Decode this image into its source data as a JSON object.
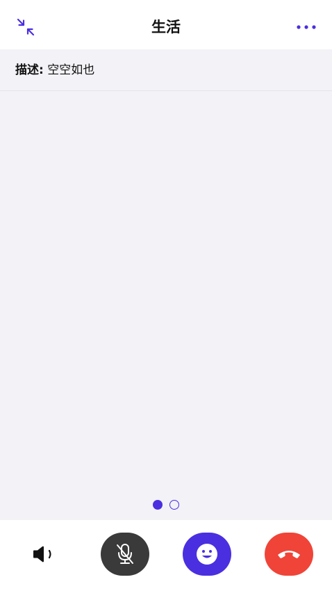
{
  "header": {
    "title": "生活",
    "collapse_icon": "collapse-arrows-icon",
    "more_icon": "more-dots-icon"
  },
  "description": {
    "label": "描述",
    "separator": ":",
    "value": "空空如也"
  },
  "pager": {
    "total": 2,
    "active_index": 0
  },
  "controls": [
    {
      "name": "speaker",
      "icon": "speaker-icon"
    },
    {
      "name": "mute-mic",
      "icon": "mic-off-icon"
    },
    {
      "name": "emoji",
      "icon": "smiley-icon"
    },
    {
      "name": "hang-up",
      "icon": "phone-hangup-icon"
    }
  ],
  "colors": {
    "accent": "#4a2fe0",
    "hangup": "#f04438",
    "mic_button": "#3a3a3a",
    "background": "#f2f2f7"
  }
}
